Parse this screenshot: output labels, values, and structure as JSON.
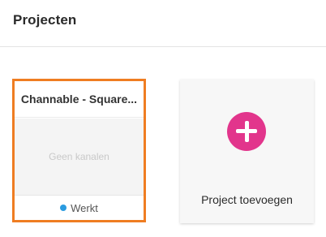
{
  "header": {
    "title": "Projecten"
  },
  "projects": [
    {
      "name": "Channable - Square...",
      "empty_text": "Geen kanalen",
      "status": "Werkt",
      "status_color": "#2b9be0",
      "selected": true
    }
  ],
  "add_project": {
    "label": "Project toevoegen",
    "icon": "plus-circle-icon",
    "icon_color": "#e2358c"
  },
  "colors": {
    "selection_border": "#ef7d22"
  }
}
